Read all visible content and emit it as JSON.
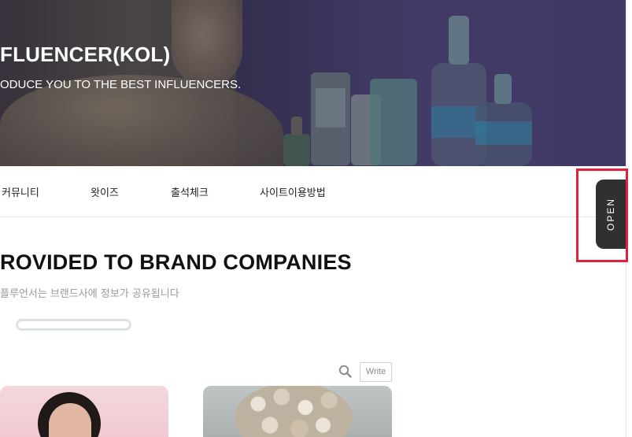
{
  "hero": {
    "title": "FLUENCER(KOL)",
    "subtitle": "ODUCE YOU TO THE BEST INFLUENCERS."
  },
  "nav": {
    "items": [
      {
        "label": "커뮤니티"
      },
      {
        "label": "왓이즈"
      },
      {
        "label": "출석체크"
      },
      {
        "label": "사이트이용방법"
      }
    ]
  },
  "side_tab": {
    "label": "OPEN",
    "highlight_color": "#e2213a",
    "tab_color": "#2f3131"
  },
  "section": {
    "title": "ROVIDED TO BRAND COMPANIES",
    "subtitle": "플루언서는 브랜드사에 정보가 공유됩니다"
  },
  "toolbar": {
    "search_icon": "search-icon",
    "write_label": "Write"
  },
  "cards": [
    {
      "image": "woman-dark-hair-pink-background"
    },
    {
      "image": "curly-blonde-hair-grey-background"
    }
  ]
}
